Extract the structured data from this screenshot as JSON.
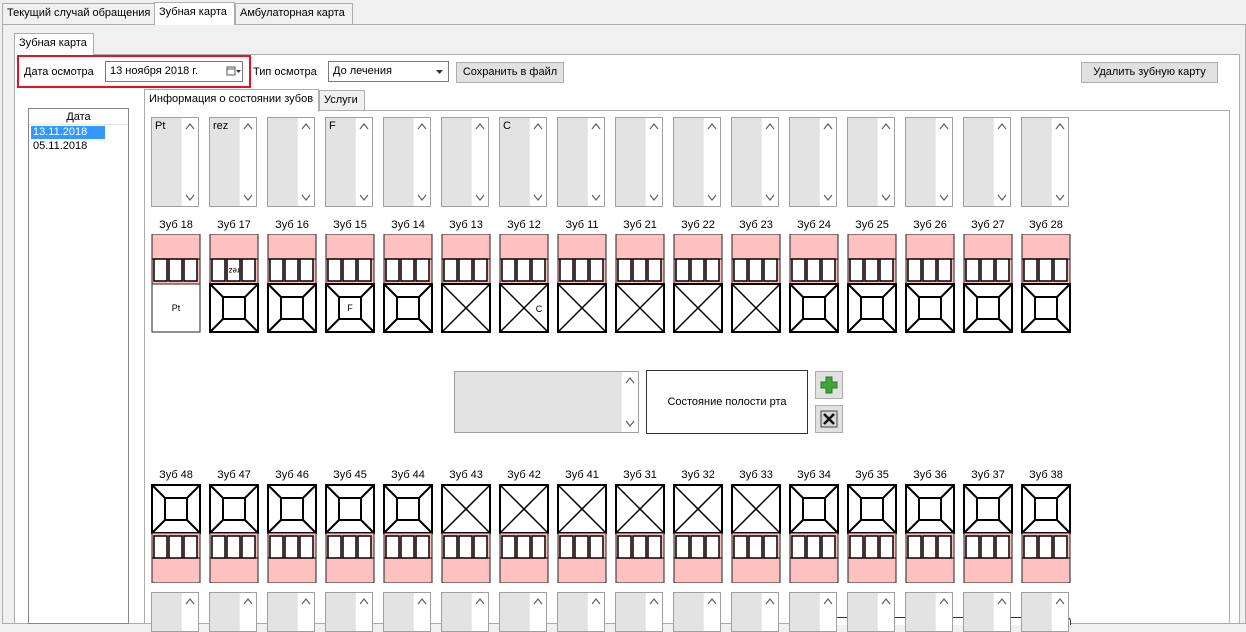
{
  "window_tabs": [
    {
      "label": "Текущий случай обращения",
      "active": false
    },
    {
      "label": "Зубная карта",
      "active": true
    },
    {
      "label": "Амбулаторная карта",
      "active": false
    }
  ],
  "sub_tab": "Зубная карта",
  "toolbar": {
    "date_label": "Дата осмотра",
    "date_value": "13  ноября  2018 г.",
    "type_label": "Тип осмотра",
    "type_value": "До лечения",
    "save_label": "Сохранить в файл",
    "delete_label": "Удалить зубную карту"
  },
  "highlight_color": "#e81123",
  "dates_list": {
    "header": "Дата",
    "items": [
      {
        "date": "13.11.2018",
        "selected": true
      },
      {
        "date": "05.11.2018",
        "selected": false
      }
    ]
  },
  "inner_tabs": [
    {
      "label": "Информация о состоянии зубов",
      "active": true
    },
    {
      "label": "Услуги",
      "active": false
    }
  ],
  "upper_teeth": [
    {
      "name": "Зуб 18",
      "note": "Pt",
      "type": "molar",
      "crown_mark": "",
      "surface": "",
      "removed": true
    },
    {
      "name": "Зуб 17",
      "note": "rez",
      "type": "molar",
      "crown_mark": "rez",
      "surface": "",
      "removed": false
    },
    {
      "name": "Зуб 16",
      "note": "",
      "type": "molar",
      "crown_mark": "",
      "surface": "",
      "removed": false
    },
    {
      "name": "Зуб 15",
      "note": "F",
      "type": "molar",
      "crown_mark": "",
      "surface": "F",
      "removed": false
    },
    {
      "name": "Зуб 14",
      "note": "",
      "type": "molar",
      "crown_mark": "",
      "surface": "",
      "removed": false
    },
    {
      "name": "Зуб 13",
      "note": "",
      "type": "incisor",
      "crown_mark": "",
      "surface": "",
      "removed": false
    },
    {
      "name": "Зуб 12",
      "note": "C",
      "type": "incisor",
      "crown_mark": "",
      "surface": "C",
      "removed": false
    },
    {
      "name": "Зуб 11",
      "note": "",
      "type": "incisor",
      "crown_mark": "",
      "surface": "",
      "removed": false
    },
    {
      "name": "Зуб 21",
      "note": "",
      "type": "incisor",
      "crown_mark": "",
      "surface": "",
      "removed": false
    },
    {
      "name": "Зуб 22",
      "note": "",
      "type": "incisor",
      "crown_mark": "",
      "surface": "",
      "removed": false
    },
    {
      "name": "Зуб 23",
      "note": "",
      "type": "incisor",
      "crown_mark": "",
      "surface": "",
      "removed": false
    },
    {
      "name": "Зуб 24",
      "note": "",
      "type": "molar",
      "crown_mark": "",
      "surface": "",
      "removed": false
    },
    {
      "name": "Зуб 25",
      "note": "",
      "type": "molar",
      "crown_mark": "",
      "surface": "",
      "removed": false
    },
    {
      "name": "Зуб 26",
      "note": "",
      "type": "molar",
      "crown_mark": "",
      "surface": "",
      "removed": false
    },
    {
      "name": "Зуб 27",
      "note": "",
      "type": "molar",
      "crown_mark": "",
      "surface": "",
      "removed": false
    },
    {
      "name": "Зуб 28",
      "note": "",
      "type": "molar",
      "crown_mark": "",
      "surface": "",
      "removed": false
    }
  ],
  "lower_teeth": [
    {
      "name": "Зуб 48",
      "type": "molar"
    },
    {
      "name": "Зуб 47",
      "type": "molar"
    },
    {
      "name": "Зуб 46",
      "type": "molar"
    },
    {
      "name": "Зуб 45",
      "type": "molar"
    },
    {
      "name": "Зуб 44",
      "type": "molar"
    },
    {
      "name": "Зуб 43",
      "type": "incisor"
    },
    {
      "name": "Зуб 42",
      "type": "incisor"
    },
    {
      "name": "Зуб 41",
      "type": "incisor"
    },
    {
      "name": "Зуб 31",
      "type": "incisor"
    },
    {
      "name": "Зуб 32",
      "type": "incisor"
    },
    {
      "name": "Зуб 33",
      "type": "incisor"
    },
    {
      "name": "Зуб 34",
      "type": "molar"
    },
    {
      "name": "Зуб 35",
      "type": "molar"
    },
    {
      "name": "Зуб 36",
      "type": "molar"
    },
    {
      "name": "Зуб 37",
      "type": "molar"
    },
    {
      "name": "Зуб 38",
      "type": "molar"
    }
  ],
  "oral_cavity": {
    "label": "Состояние полости рта",
    "add_icon_color": "#3fa535",
    "delete_icon": "x-icon"
  },
  "colors": {
    "crown_pink": "#ffc0c0",
    "selection_blue": "#3399ff"
  }
}
